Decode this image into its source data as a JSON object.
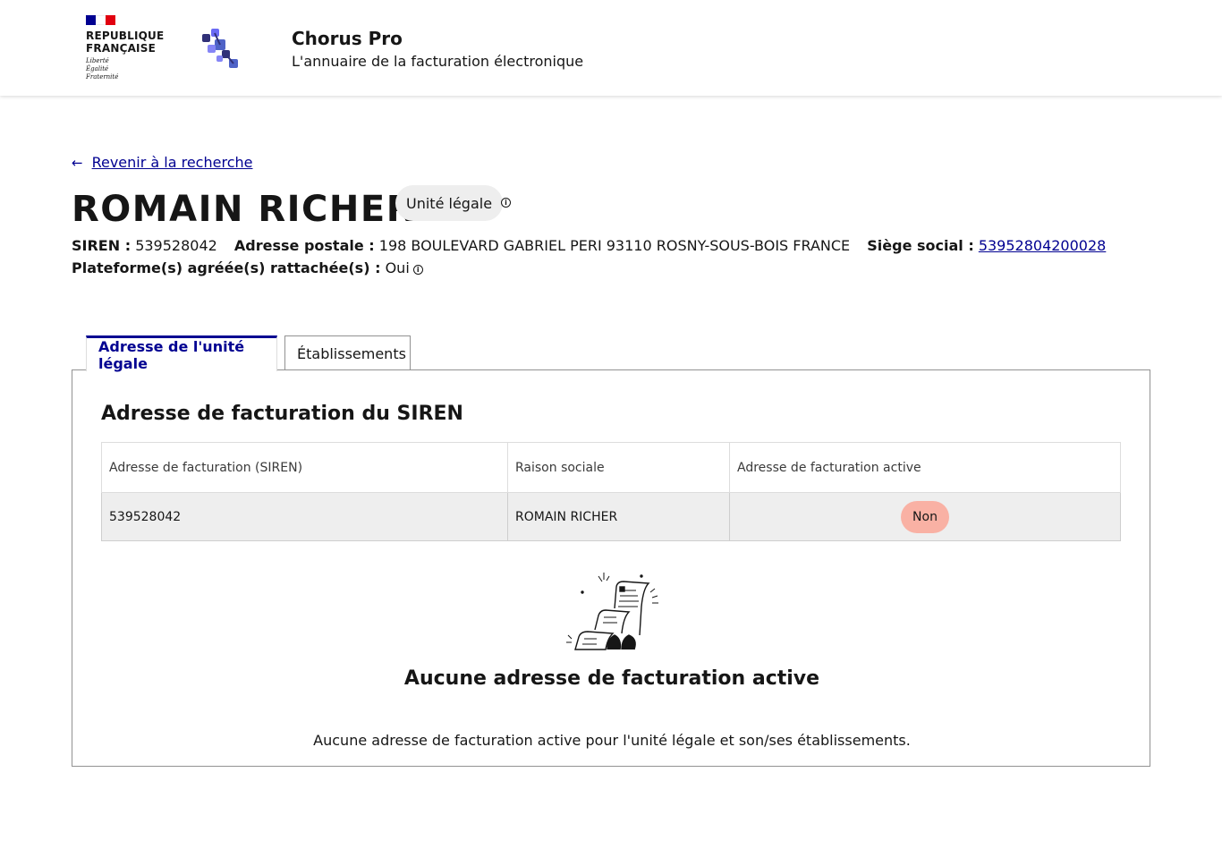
{
  "header": {
    "rf_line1": "REPUBLIQUE",
    "rf_line2": "FRANÇAISE",
    "devise1": "Liberté",
    "devise2": "Égalité",
    "devise3": "Fraternité",
    "app_title": "Chorus Pro",
    "app_subtitle": "L'annuaire de la facturation électronique"
  },
  "nav": {
    "back_label": "Revenir à la recherche"
  },
  "entity": {
    "name": "ROMAIN RICHER",
    "badge": "Unité légale",
    "siren_label": "SIREN :",
    "siren": "539528042",
    "address_label": "Adresse postale :",
    "address": "198 BOULEVARD GABRIEL PERI 93110 ROSNY-SOUS-BOIS FRANCE",
    "siege_label": "Siège social :",
    "siege": "53952804200028",
    "platform_label": "Plateforme(s) agréée(s) rattachée(s) :",
    "platform_value": "Oui"
  },
  "tabs": [
    {
      "label": "Adresse de l'unité légale",
      "active": true
    },
    {
      "label": "Établissements",
      "active": false
    }
  ],
  "section": {
    "title": "Adresse de facturation du SIREN",
    "columns": [
      "Adresse de facturation (SIREN)",
      "Raison sociale",
      "Adresse de facturation active"
    ],
    "rows": [
      {
        "siren": "539528042",
        "raison": "ROMAIN RICHER",
        "active": "Non"
      }
    ]
  },
  "empty_state": {
    "title": "Aucune adresse de facturation active",
    "text": "Aucune adresse de facturation active pour l'unité légale et son/ses établissements."
  },
  "colors": {
    "primary": "#000091",
    "flag_blue": "#000091",
    "flag_white": "#ffffff",
    "flag_red": "#e1000f",
    "badge_bg": "#eeeeee",
    "pill_non": "#f9b1a4"
  }
}
